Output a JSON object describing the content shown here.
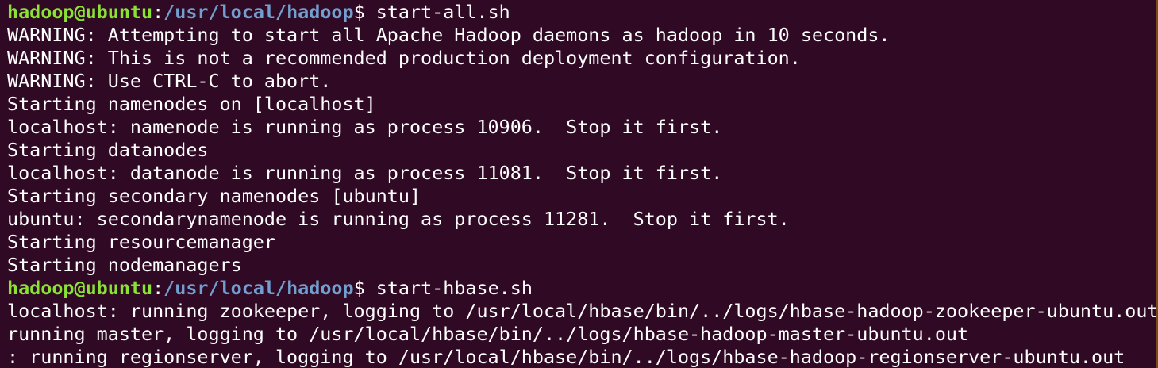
{
  "terminal": {
    "prompt": {
      "user_host": "hadoop@ubuntu",
      "separator": ":",
      "path": "/usr/local/hadoop",
      "dollar": "$ "
    },
    "colors": {
      "background": "#300a24",
      "prompt_user": "#8ae234",
      "prompt_path": "#729fcf",
      "text": "#ffffff"
    },
    "commands": {
      "first": "start-all.sh",
      "second": "start-hbase.sh"
    },
    "output_first": [
      "WARNING: Attempting to start all Apache Hadoop daemons as hadoop in 10 seconds.",
      "WARNING: This is not a recommended production deployment configuration.",
      "WARNING: Use CTRL-C to abort.",
      "Starting namenodes on [localhost]",
      "localhost: namenode is running as process 10906.  Stop it first.",
      "Starting datanodes",
      "localhost: datanode is running as process 11081.  Stop it first.",
      "Starting secondary namenodes [ubuntu]",
      "ubuntu: secondarynamenode is running as process 11281.  Stop it first.",
      "Starting resourcemanager",
      "Starting nodemanagers"
    ],
    "output_second": [
      "localhost: running zookeeper, logging to /usr/local/hbase/bin/../logs/hbase-hadoop-zookeeper-ubuntu.out",
      "running master, logging to /usr/local/hbase/bin/../logs/hbase-hadoop-master-ubuntu.out",
      ": running regionserver, logging to /usr/local/hbase/bin/../logs/hbase-hadoop-regionserver-ubuntu.out"
    ]
  }
}
